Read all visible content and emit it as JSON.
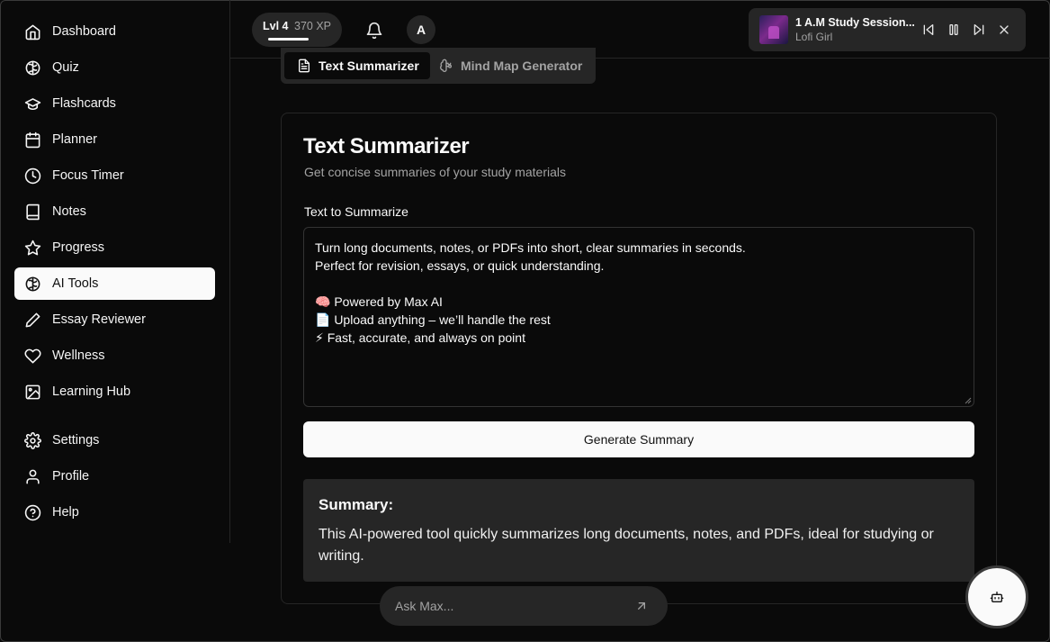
{
  "sidebar": {
    "items": [
      {
        "label": "Dashboard",
        "icon": "home-icon"
      },
      {
        "label": "Quiz",
        "icon": "brain-icon"
      },
      {
        "label": "Flashcards",
        "icon": "graduation-cap-icon"
      },
      {
        "label": "Planner",
        "icon": "calendar-icon"
      },
      {
        "label": "Focus Timer",
        "icon": "clock-icon"
      },
      {
        "label": "Notes",
        "icon": "book-icon"
      },
      {
        "label": "Progress",
        "icon": "star-icon"
      },
      {
        "label": "AI Tools",
        "icon": "brain-icon",
        "active": true
      },
      {
        "label": "Essay Reviewer",
        "icon": "pen-icon"
      },
      {
        "label": "Wellness",
        "icon": "heart-icon"
      },
      {
        "label": "Learning Hub",
        "icon": "image-icon"
      }
    ],
    "bottom_items": [
      {
        "label": "Settings",
        "icon": "gear-icon"
      },
      {
        "label": "Profile",
        "icon": "user-icon"
      },
      {
        "label": "Help",
        "icon": "help-circle-icon"
      }
    ]
  },
  "topbar": {
    "level": "Lvl 4",
    "xp": "370 XP",
    "xp_progress": 0.45,
    "avatar_initial": "A"
  },
  "player": {
    "title": "1 A.M Study Session...",
    "artist": "Lofi Girl"
  },
  "tabs": [
    {
      "label": "Text Summarizer",
      "active": true
    },
    {
      "label": "Mind Map Generator",
      "active": false
    }
  ],
  "card": {
    "title": "Text Summarizer",
    "subtitle": "Get concise summaries of your study materials",
    "input_label": "Text to Summarize",
    "input_value": "Turn long documents, notes, or PDFs into short, clear summaries in seconds.\nPerfect for revision, essays, or quick understanding.\n\n🧠 Powered by Max AI\n📄 Upload anything – we’ll handle the rest\n⚡ Fast, accurate, and always on point",
    "button_label": "Generate Summary",
    "summary_title": "Summary:",
    "summary_text": "This AI-powered tool quickly summarizes long documents, notes, and PDFs, ideal for studying or writing."
  },
  "ask": {
    "placeholder": "Ask Max..."
  },
  "colors": {
    "background": "#0a0a0a",
    "surface": "#262626",
    "accent": "#fafafa",
    "muted_text": "#a3a3a3"
  }
}
